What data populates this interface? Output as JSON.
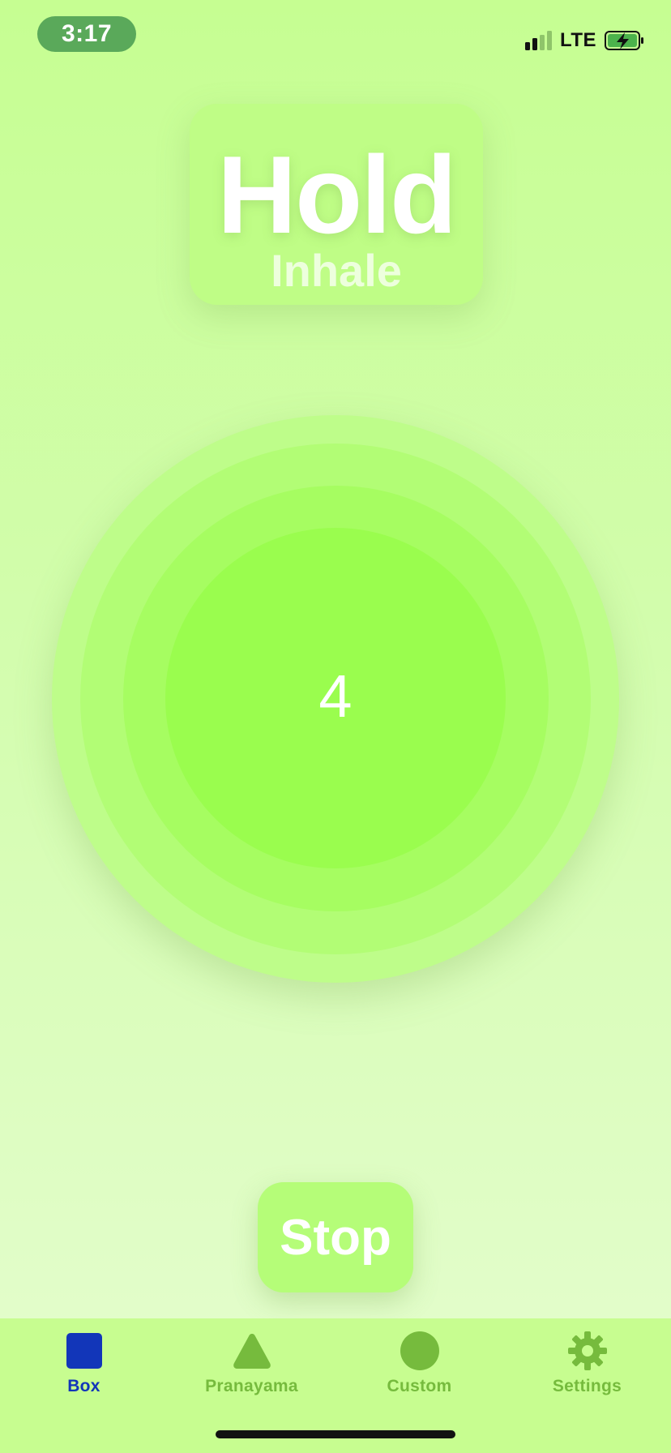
{
  "colors": {
    "background_top": "#c6fe92",
    "background_bottom": "#e5fdcf",
    "accent_green": "#9afd4e",
    "tab_inactive": "#76bb3d",
    "tab_active": "#1236b9",
    "time_pill": "#5aa95a"
  },
  "status_bar": {
    "time": "3:17",
    "network": "LTE",
    "signal_bars_active": 2,
    "signal_bars_total": 4,
    "battery_icon": "battery-charging-icon"
  },
  "phase": {
    "current": "Hold",
    "next": "Inhale"
  },
  "breath_circle": {
    "countdown": "4"
  },
  "controls": {
    "stop_label": "Stop"
  },
  "tab_bar": {
    "selected_tab": "Box",
    "tabs": [
      {
        "label": "Box",
        "icon": "square-icon",
        "selected": true
      },
      {
        "label": "Pranayama",
        "icon": "triangle-icon",
        "selected": false
      },
      {
        "label": "Custom",
        "icon": "circle-icon",
        "selected": false
      },
      {
        "label": "Settings",
        "icon": "gear-icon",
        "selected": false
      }
    ]
  }
}
